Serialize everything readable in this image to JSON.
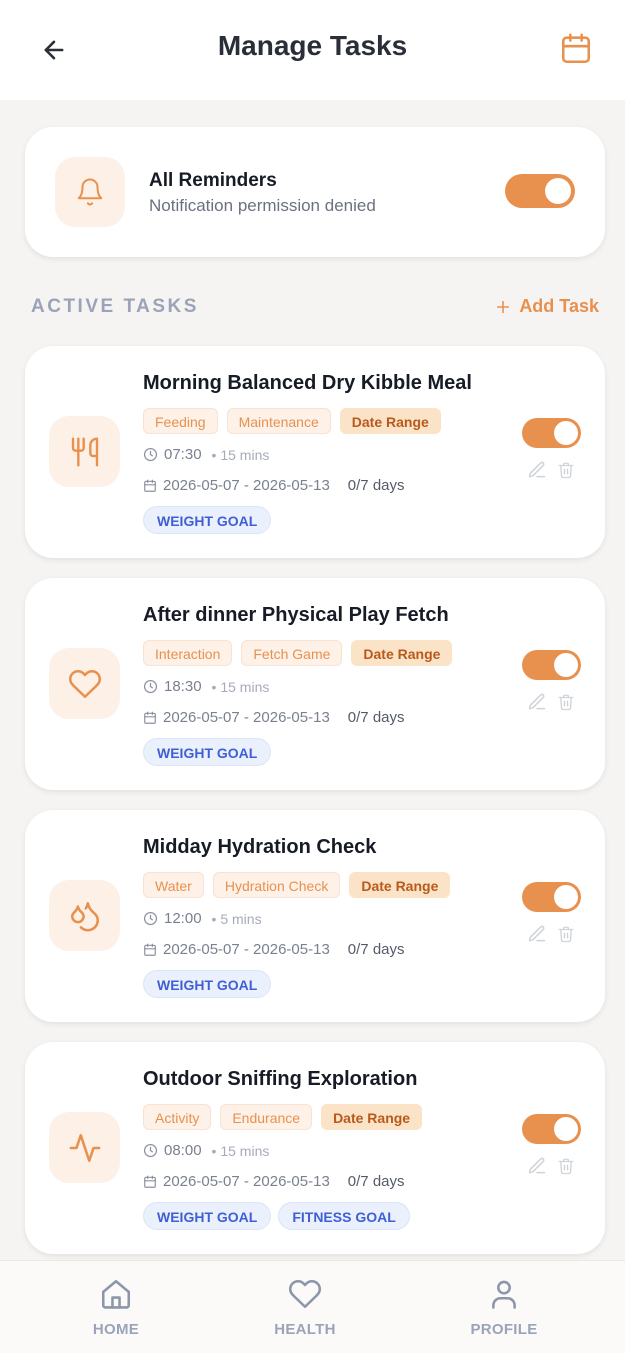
{
  "header": {
    "title": "Manage Tasks",
    "back_icon": "arrow-left-icon",
    "calendar_icon": "calendar-icon"
  },
  "reminders": {
    "title": "All Reminders",
    "subtitle": "Notification permission denied",
    "enabled": true,
    "icon": "bell-icon"
  },
  "section": {
    "title": "ACTIVE TASKS",
    "add_label": "Add Task"
  },
  "tasks": [
    {
      "title": "Morning Balanced Dry Kibble Meal",
      "icon": "utensils-icon",
      "tags": [
        "Feeding",
        "Maintenance"
      ],
      "range_label": "Date Range",
      "time": "07:30",
      "duration": "• 15 mins",
      "dates": "2026-05-07 - 2026-05-13",
      "days": "0/7 days",
      "goals": [
        "WEIGHT GOAL"
      ],
      "enabled": true
    },
    {
      "title": "After dinner Physical Play Fetch",
      "icon": "heart-icon",
      "tags": [
        "Interaction",
        "Fetch Game"
      ],
      "range_label": "Date Range",
      "time": "18:30",
      "duration": "• 15 mins",
      "dates": "2026-05-07 - 2026-05-13",
      "days": "0/7 days",
      "goals": [
        "WEIGHT GOAL"
      ],
      "enabled": true
    },
    {
      "title": "Midday Hydration Check",
      "icon": "droplets-icon",
      "tags": [
        "Water",
        "Hydration Check"
      ],
      "range_label": "Date Range",
      "time": "12:00",
      "duration": "• 5 mins",
      "dates": "2026-05-07 - 2026-05-13",
      "days": "0/7 days",
      "goals": [
        "WEIGHT GOAL"
      ],
      "enabled": true
    },
    {
      "title": "Outdoor Sniffing Exploration",
      "icon": "activity-icon",
      "tags": [
        "Activity",
        "Endurance"
      ],
      "range_label": "Date Range",
      "time": "08:00",
      "duration": "• 15 mins",
      "dates": "2026-05-07 - 2026-05-13",
      "days": "0/7 days",
      "goals": [
        "WEIGHT GOAL",
        "FITNESS GOAL"
      ],
      "enabled": true
    }
  ],
  "nav": [
    {
      "label": "HOME",
      "icon": "home-icon"
    },
    {
      "label": "HEALTH",
      "icon": "heart-icon"
    },
    {
      "label": "PROFILE",
      "icon": "user-icon"
    }
  ],
  "colors": {
    "accent": "#e8914f",
    "accent_soft": "#fdf1e7",
    "goal_text": "#3f5fd6",
    "muted": "#9aa3b7"
  }
}
